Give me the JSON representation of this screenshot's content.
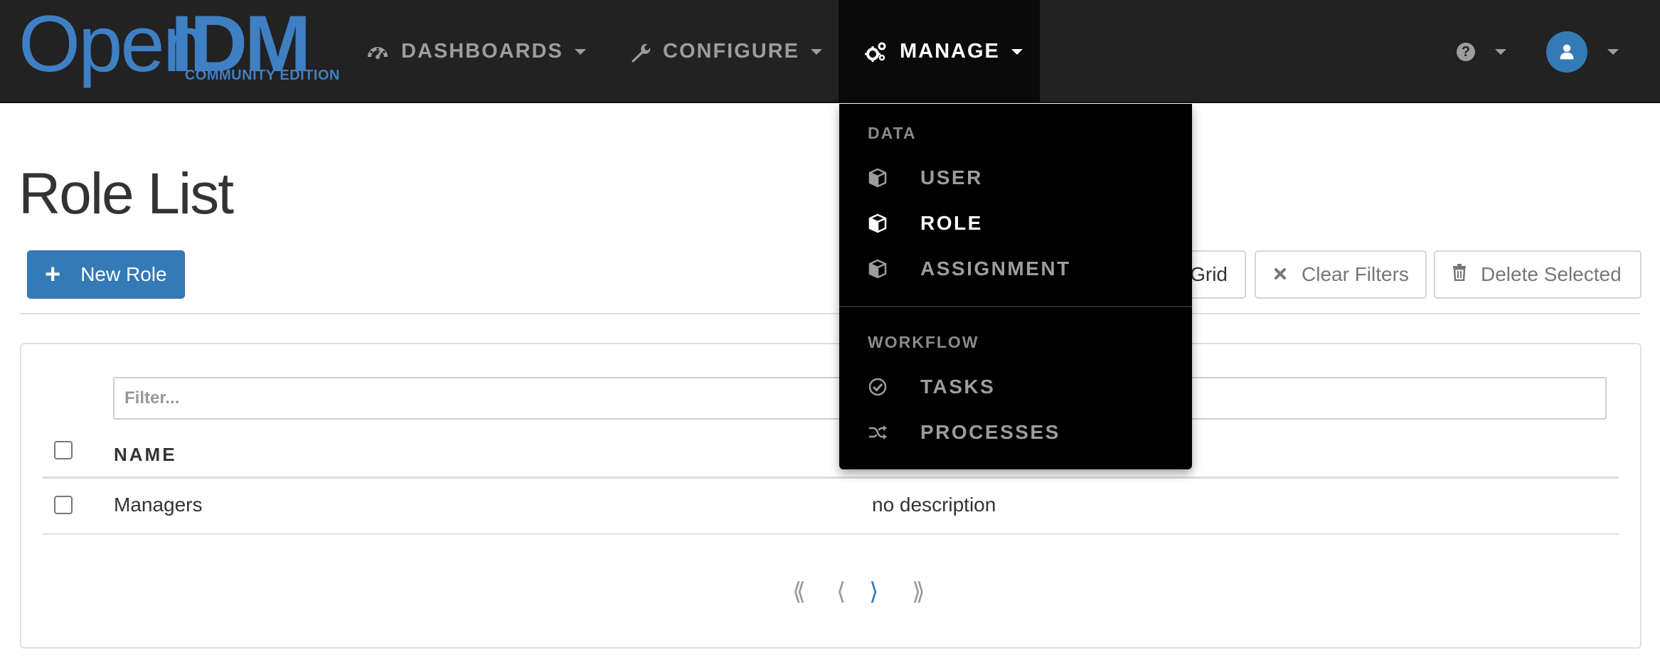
{
  "brand": {
    "logo_open": "Open",
    "logo_idm": "IDM",
    "edition": "COMMUNITY EDITION",
    "color": "#3f7fc4"
  },
  "navbar": {
    "dashboards": {
      "label": "DASHBOARDS",
      "icon": "dashboard-icon"
    },
    "configure": {
      "label": "CONFIGURE",
      "icon": "wrench-icon"
    },
    "manage": {
      "label": "MANAGE",
      "icon": "gears-icon"
    },
    "help": {
      "icon": "help-icon",
      "glyph": "?"
    },
    "user": {
      "icon": "user-icon"
    }
  },
  "page": {
    "title": "Role List"
  },
  "toolbar": {
    "new_label": "New Role",
    "grid_label": "Grid",
    "clear_label": "Clear Filters",
    "delete_label": "Delete Selected"
  },
  "table": {
    "filter_placeholder": "Filter...",
    "columns": [
      "NAME"
    ],
    "rows": [
      {
        "name": "Managers",
        "description": "no description"
      }
    ]
  },
  "pagination": {
    "first": "⟪",
    "prev": "⟨",
    "next": "⟩",
    "last": "⟫"
  },
  "manage_menu": {
    "sections": [
      {
        "header": "DATA",
        "items": [
          {
            "label": "USER",
            "icon": "cube-icon",
            "active": false
          },
          {
            "label": "ROLE",
            "icon": "cube-icon",
            "active": true
          },
          {
            "label": "ASSIGNMENT",
            "icon": "cube-icon",
            "active": false
          }
        ]
      },
      {
        "header": "WORKFLOW",
        "items": [
          {
            "label": "TASKS",
            "icon": "check-circle-icon",
            "active": false
          },
          {
            "label": "PROCESSES",
            "icon": "random-icon",
            "active": false
          }
        ]
      }
    ]
  },
  "colors": {
    "navbar_bg": "#222222",
    "menu_bg": "#000000",
    "primary": "#337ab7"
  }
}
